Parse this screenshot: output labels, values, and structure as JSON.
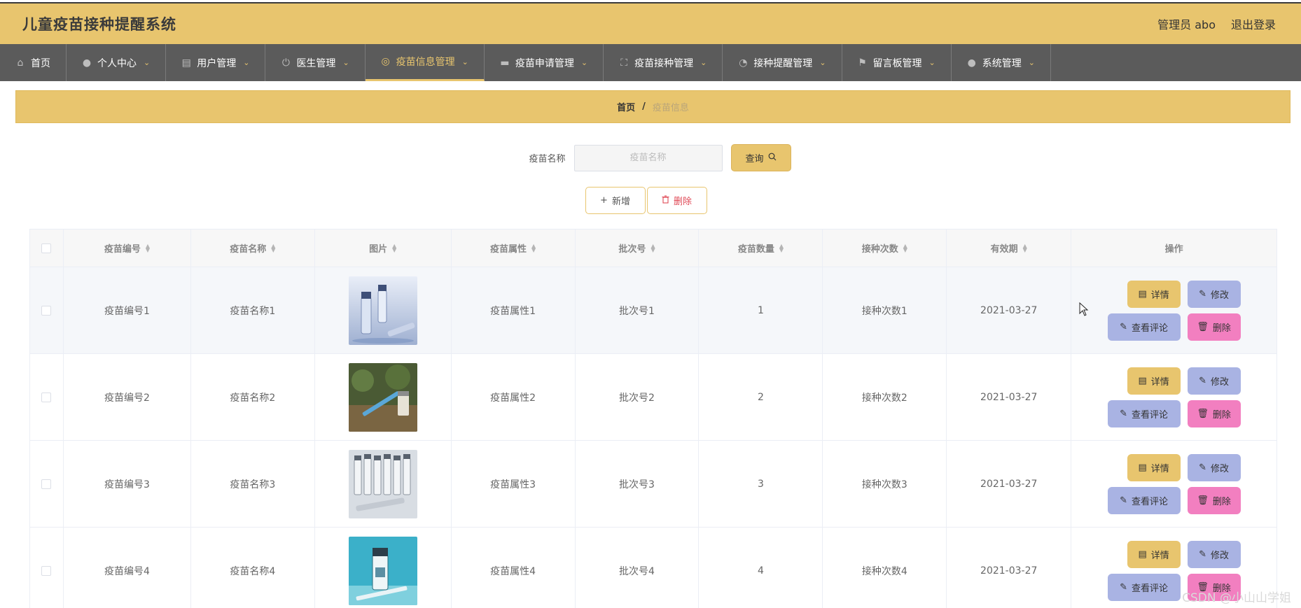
{
  "header": {
    "title": "儿童疫苗接种提醒系统",
    "user_label": "管理员 abo",
    "logout_label": "退出登录"
  },
  "nav": {
    "items": [
      {
        "label": "首页",
        "icon": "home-icon",
        "has_menu": false
      },
      {
        "label": "个人中心",
        "icon": "user-icon",
        "has_menu": true
      },
      {
        "label": "用户管理",
        "icon": "document-icon",
        "has_menu": true
      },
      {
        "label": "医生管理",
        "icon": "power-icon",
        "has_menu": true
      },
      {
        "label": "疫苗信息管理",
        "icon": "compass-icon",
        "has_menu": true,
        "active": true
      },
      {
        "label": "疫苗申请管理",
        "icon": "ticket-icon",
        "has_menu": true
      },
      {
        "label": "疫苗接种管理",
        "icon": "fullscreen-icon",
        "has_menu": true
      },
      {
        "label": "接种提醒管理",
        "icon": "gauge-icon",
        "has_menu": true
      },
      {
        "label": "留言板管理",
        "icon": "flag-icon",
        "has_menu": true
      },
      {
        "label": "系统管理",
        "icon": "user-icon",
        "has_menu": true
      }
    ]
  },
  "breadcrumb": {
    "home": "首页",
    "separator": "/",
    "current": "疫苗信息"
  },
  "search": {
    "label": "疫苗名称",
    "placeholder": "疫苗名称",
    "query_label": "查询"
  },
  "actions": {
    "add_label": "新增",
    "delete_label": "删除"
  },
  "table": {
    "columns": [
      "疫苗编号",
      "疫苗名称",
      "图片",
      "疫苗属性",
      "批次号",
      "疫苗数量",
      "接种次数",
      "有效期",
      "操作"
    ],
    "rows": [
      {
        "code": "疫苗编号1",
        "name": "疫苗名称1",
        "attr": "疫苗属性1",
        "batch": "批次号1",
        "qty": "1",
        "times": "接种次数1",
        "expiry": "2021-03-27",
        "image": "vials-clear"
      },
      {
        "code": "疫苗编号2",
        "name": "疫苗名称2",
        "attr": "疫苗属性2",
        "batch": "批次号2",
        "qty": "2",
        "times": "接种次数2",
        "expiry": "2021-03-27",
        "image": "syringe-vial"
      },
      {
        "code": "疫苗编号3",
        "name": "疫苗名称3",
        "attr": "疫苗属性3",
        "batch": "批次号3",
        "qty": "3",
        "times": "接种次数3",
        "expiry": "2021-03-27",
        "image": "vials-row"
      },
      {
        "code": "疫苗编号4",
        "name": "疫苗名称4",
        "attr": "疫苗属性4",
        "batch": "批次号4",
        "qty": "4",
        "times": "接种次数4",
        "expiry": "2021-03-27",
        "image": "vial-blue"
      }
    ],
    "row_actions": {
      "detail": "详情",
      "edit": "修改",
      "review": "查看评论",
      "remove": "删除"
    }
  },
  "watermark": "CSDN @小山山学姐",
  "colors": {
    "accent": "#e8c56e",
    "nav_bg": "#5b5b5b",
    "edit_btn": "#a9b3e3",
    "delete_btn": "#f27fc0",
    "delete_text": "#e04a57"
  }
}
